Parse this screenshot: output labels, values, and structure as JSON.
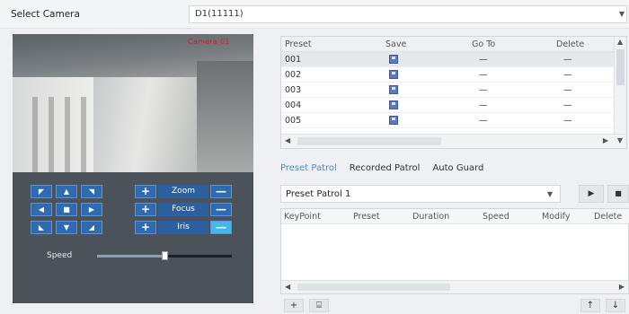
{
  "camera_row": {
    "label": "Select Camera",
    "selected": "D1(11111)"
  },
  "video": {
    "overlay_text": "Camera 01"
  },
  "ptz": {
    "pad_icons": [
      "up-left",
      "up",
      "up-right",
      "left",
      "center",
      "right",
      "down-left",
      "down",
      "down-right"
    ],
    "lens": [
      {
        "name": "Zoom",
        "plus": "+",
        "minus": "—"
      },
      {
        "name": "Focus",
        "plus": "+",
        "minus": "—"
      },
      {
        "name": "Iris",
        "plus": "+",
        "minus": "—"
      }
    ],
    "speed_label": "Speed",
    "speed_value": 0.5
  },
  "preset_table": {
    "columns": [
      "Preset",
      "Save",
      "Go To",
      "Delete"
    ],
    "rows": [
      {
        "preset": "001",
        "goto": "—",
        "delete": "—"
      },
      {
        "preset": "002",
        "goto": "—",
        "delete": "—"
      },
      {
        "preset": "003",
        "goto": "—",
        "delete": "—"
      },
      {
        "preset": "004",
        "goto": "—",
        "delete": "—"
      },
      {
        "preset": "005",
        "goto": "—",
        "delete": "—"
      }
    ]
  },
  "tabs": [
    "Preset Patrol",
    "Recorded Patrol",
    "Auto Guard"
  ],
  "patrol": {
    "selected": "Preset Patrol 1",
    "play": "▶",
    "stop": "■"
  },
  "keypoint_table": {
    "columns": [
      "KeyPoint",
      "Preset",
      "Duration",
      "Speed",
      "Modify",
      "Delete"
    ]
  },
  "bottom_bar": {
    "add": "+",
    "delete": "⌸",
    "up": "↑",
    "down": "↓"
  },
  "colors": {
    "accent": "#4a90c8",
    "ptz_button": "#2e6bb3",
    "overlay_red": "#c0252b"
  }
}
